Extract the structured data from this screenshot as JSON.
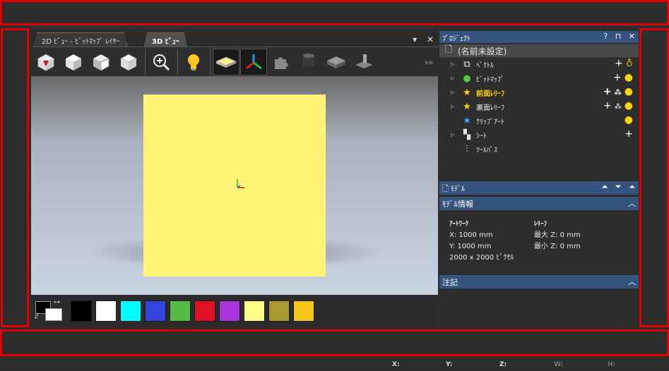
{
  "tabs": [
    {
      "label": "2D ﾋﾞｭｰ - ﾋﾞｯﾄﾏｯﾌﾟ ﾚｲﾔｰ"
    },
    {
      "label": "3D ﾋﾞｭｰ"
    }
  ],
  "tab_controls": {
    "menu": "▾",
    "close": "✕"
  },
  "toolbar_icons": [
    "iso-view-icon",
    "front-view-icon",
    "right-view-icon",
    "top-view-icon",
    "zoom-icon",
    "light-bulb-icon",
    "plate-icon",
    "axes-icon",
    "puzzle-icon",
    "cylinder-icon",
    "block-icon",
    "toolpath-icon"
  ],
  "swatches": [
    "#000000",
    "#ffffff",
    "#00ffff",
    "#3344dd",
    "#55bb44",
    "#dd1122",
    "#aa33dd",
    "#ffff88",
    "#a89a30",
    "#f5c518"
  ],
  "project_panel": {
    "title": "ﾌﾟﾛｼﾞｪｸﾄ",
    "controls": [
      "?",
      "⊓",
      "✕"
    ],
    "root": "(名前未設定)",
    "items": [
      {
        "label": "ﾍﾞｸﾄﾙ",
        "icon": "vector-icon"
      },
      {
        "label": "ﾋﾞｯﾄﾏｯﾌﾟ",
        "icon": "bitmap-icon"
      },
      {
        "label": "前面ﾚﾘｰﾌ",
        "icon": "star-icon"
      },
      {
        "label": "裏面ﾚﾘｰﾌ",
        "icon": "star-icon"
      },
      {
        "label": "ｸﾘｯﾌﾟｱｰﾄ",
        "icon": "star-icon"
      },
      {
        "label": "ｼｰﾄ",
        "icon": "sheet-icon"
      },
      {
        "label": "ﾂｰﾙﾊﾟｽ",
        "icon": "toolpath-icon"
      }
    ]
  },
  "model_panel": {
    "title": "ﾓﾃﾞﾙ"
  },
  "model_info": {
    "title": "ﾓﾃﾞﾙ情報",
    "artwork_heading": "ｱｰﾄﾜｰｸ",
    "x": "X: 1000 mm",
    "y": "Y: 1000 mm",
    "pixels": "2000 x 2000 ﾋﾟｸｾﾙ",
    "relief_heading": "ﾚﾘｰﾌ",
    "max_z": "最大 Z: 0 mm",
    "min_z": "最小 Z: 0 mm"
  },
  "notes": {
    "title": "注記"
  },
  "status": {
    "x": "X:",
    "y": "Y:",
    "z": "Z:",
    "w": "W:",
    "h": "H:"
  }
}
